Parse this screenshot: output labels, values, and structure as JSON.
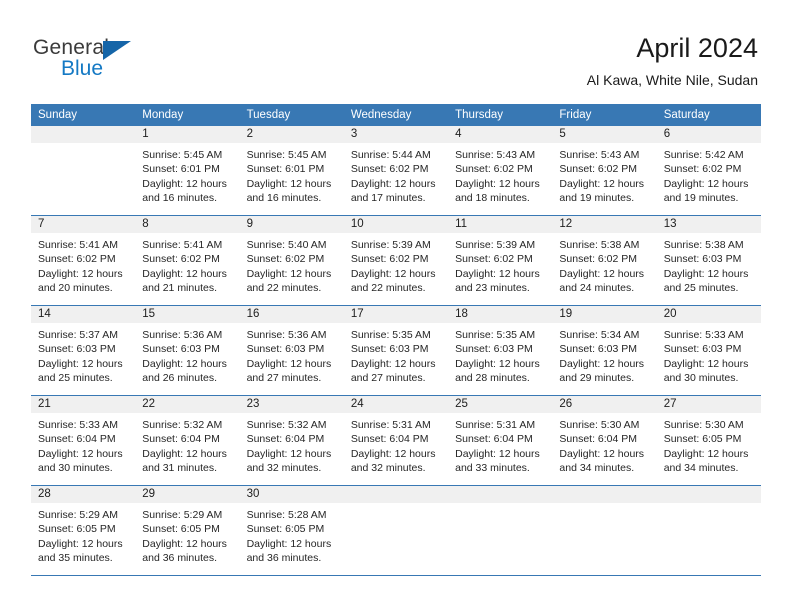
{
  "logo": {
    "word1": "General",
    "word2": "Blue",
    "triangle_color": "#1565a8",
    "blue_text_color": "#1479c4"
  },
  "header": {
    "title": "April 2024",
    "subtitle": "Al Kawa, White Nile, Sudan"
  },
  "colors": {
    "header_row_bg": "#3878b4",
    "header_row_text": "#ffffff",
    "daynum_bg": "#f0f0f0",
    "grid_line": "#3878b4"
  },
  "weekday_headers": [
    "Sunday",
    "Monday",
    "Tuesday",
    "Wednesday",
    "Thursday",
    "Friday",
    "Saturday"
  ],
  "weeks": [
    [
      {
        "day": "",
        "blank": true,
        "sunrise": "",
        "sunset": "",
        "daylight1": "",
        "daylight2": ""
      },
      {
        "day": "1",
        "sunrise": "Sunrise: 5:45 AM",
        "sunset": "Sunset: 6:01 PM",
        "daylight1": "Daylight: 12 hours",
        "daylight2": "and 16 minutes."
      },
      {
        "day": "2",
        "sunrise": "Sunrise: 5:45 AM",
        "sunset": "Sunset: 6:01 PM",
        "daylight1": "Daylight: 12 hours",
        "daylight2": "and 16 minutes."
      },
      {
        "day": "3",
        "sunrise": "Sunrise: 5:44 AM",
        "sunset": "Sunset: 6:02 PM",
        "daylight1": "Daylight: 12 hours",
        "daylight2": "and 17 minutes."
      },
      {
        "day": "4",
        "sunrise": "Sunrise: 5:43 AM",
        "sunset": "Sunset: 6:02 PM",
        "daylight1": "Daylight: 12 hours",
        "daylight2": "and 18 minutes."
      },
      {
        "day": "5",
        "sunrise": "Sunrise: 5:43 AM",
        "sunset": "Sunset: 6:02 PM",
        "daylight1": "Daylight: 12 hours",
        "daylight2": "and 19 minutes."
      },
      {
        "day": "6",
        "sunrise": "Sunrise: 5:42 AM",
        "sunset": "Sunset: 6:02 PM",
        "daylight1": "Daylight: 12 hours",
        "daylight2": "and 19 minutes."
      }
    ],
    [
      {
        "day": "7",
        "sunrise": "Sunrise: 5:41 AM",
        "sunset": "Sunset: 6:02 PM",
        "daylight1": "Daylight: 12 hours",
        "daylight2": "and 20 minutes."
      },
      {
        "day": "8",
        "sunrise": "Sunrise: 5:41 AM",
        "sunset": "Sunset: 6:02 PM",
        "daylight1": "Daylight: 12 hours",
        "daylight2": "and 21 minutes."
      },
      {
        "day": "9",
        "sunrise": "Sunrise: 5:40 AM",
        "sunset": "Sunset: 6:02 PM",
        "daylight1": "Daylight: 12 hours",
        "daylight2": "and 22 minutes."
      },
      {
        "day": "10",
        "sunrise": "Sunrise: 5:39 AM",
        "sunset": "Sunset: 6:02 PM",
        "daylight1": "Daylight: 12 hours",
        "daylight2": "and 22 minutes."
      },
      {
        "day": "11",
        "sunrise": "Sunrise: 5:39 AM",
        "sunset": "Sunset: 6:02 PM",
        "daylight1": "Daylight: 12 hours",
        "daylight2": "and 23 minutes."
      },
      {
        "day": "12",
        "sunrise": "Sunrise: 5:38 AM",
        "sunset": "Sunset: 6:02 PM",
        "daylight1": "Daylight: 12 hours",
        "daylight2": "and 24 minutes."
      },
      {
        "day": "13",
        "sunrise": "Sunrise: 5:38 AM",
        "sunset": "Sunset: 6:03 PM",
        "daylight1": "Daylight: 12 hours",
        "daylight2": "and 25 minutes."
      }
    ],
    [
      {
        "day": "14",
        "sunrise": "Sunrise: 5:37 AM",
        "sunset": "Sunset: 6:03 PM",
        "daylight1": "Daylight: 12 hours",
        "daylight2": "and 25 minutes."
      },
      {
        "day": "15",
        "sunrise": "Sunrise: 5:36 AM",
        "sunset": "Sunset: 6:03 PM",
        "daylight1": "Daylight: 12 hours",
        "daylight2": "and 26 minutes."
      },
      {
        "day": "16",
        "sunrise": "Sunrise: 5:36 AM",
        "sunset": "Sunset: 6:03 PM",
        "daylight1": "Daylight: 12 hours",
        "daylight2": "and 27 minutes."
      },
      {
        "day": "17",
        "sunrise": "Sunrise: 5:35 AM",
        "sunset": "Sunset: 6:03 PM",
        "daylight1": "Daylight: 12 hours",
        "daylight2": "and 27 minutes."
      },
      {
        "day": "18",
        "sunrise": "Sunrise: 5:35 AM",
        "sunset": "Sunset: 6:03 PM",
        "daylight1": "Daylight: 12 hours",
        "daylight2": "and 28 minutes."
      },
      {
        "day": "19",
        "sunrise": "Sunrise: 5:34 AM",
        "sunset": "Sunset: 6:03 PM",
        "daylight1": "Daylight: 12 hours",
        "daylight2": "and 29 minutes."
      },
      {
        "day": "20",
        "sunrise": "Sunrise: 5:33 AM",
        "sunset": "Sunset: 6:03 PM",
        "daylight1": "Daylight: 12 hours",
        "daylight2": "and 30 minutes."
      }
    ],
    [
      {
        "day": "21",
        "sunrise": "Sunrise: 5:33 AM",
        "sunset": "Sunset: 6:04 PM",
        "daylight1": "Daylight: 12 hours",
        "daylight2": "and 30 minutes."
      },
      {
        "day": "22",
        "sunrise": "Sunrise: 5:32 AM",
        "sunset": "Sunset: 6:04 PM",
        "daylight1": "Daylight: 12 hours",
        "daylight2": "and 31 minutes."
      },
      {
        "day": "23",
        "sunrise": "Sunrise: 5:32 AM",
        "sunset": "Sunset: 6:04 PM",
        "daylight1": "Daylight: 12 hours",
        "daylight2": "and 32 minutes."
      },
      {
        "day": "24",
        "sunrise": "Sunrise: 5:31 AM",
        "sunset": "Sunset: 6:04 PM",
        "daylight1": "Daylight: 12 hours",
        "daylight2": "and 32 minutes."
      },
      {
        "day": "25",
        "sunrise": "Sunrise: 5:31 AM",
        "sunset": "Sunset: 6:04 PM",
        "daylight1": "Daylight: 12 hours",
        "daylight2": "and 33 minutes."
      },
      {
        "day": "26",
        "sunrise": "Sunrise: 5:30 AM",
        "sunset": "Sunset: 6:04 PM",
        "daylight1": "Daylight: 12 hours",
        "daylight2": "and 34 minutes."
      },
      {
        "day": "27",
        "sunrise": "Sunrise: 5:30 AM",
        "sunset": "Sunset: 6:05 PM",
        "daylight1": "Daylight: 12 hours",
        "daylight2": "and 34 minutes."
      }
    ],
    [
      {
        "day": "28",
        "sunrise": "Sunrise: 5:29 AM",
        "sunset": "Sunset: 6:05 PM",
        "daylight1": "Daylight: 12 hours",
        "daylight2": "and 35 minutes."
      },
      {
        "day": "29",
        "sunrise": "Sunrise: 5:29 AM",
        "sunset": "Sunset: 6:05 PM",
        "daylight1": "Daylight: 12 hours",
        "daylight2": "and 36 minutes."
      },
      {
        "day": "30",
        "sunrise": "Sunrise: 5:28 AM",
        "sunset": "Sunset: 6:05 PM",
        "daylight1": "Daylight: 12 hours",
        "daylight2": "and 36 minutes."
      },
      {
        "day": "",
        "blank": true,
        "sunrise": "",
        "sunset": "",
        "daylight1": "",
        "daylight2": ""
      },
      {
        "day": "",
        "blank": true,
        "sunrise": "",
        "sunset": "",
        "daylight1": "",
        "daylight2": ""
      },
      {
        "day": "",
        "blank": true,
        "sunrise": "",
        "sunset": "",
        "daylight1": "",
        "daylight2": ""
      },
      {
        "day": "",
        "blank": true,
        "sunrise": "",
        "sunset": "",
        "daylight1": "",
        "daylight2": ""
      }
    ]
  ]
}
